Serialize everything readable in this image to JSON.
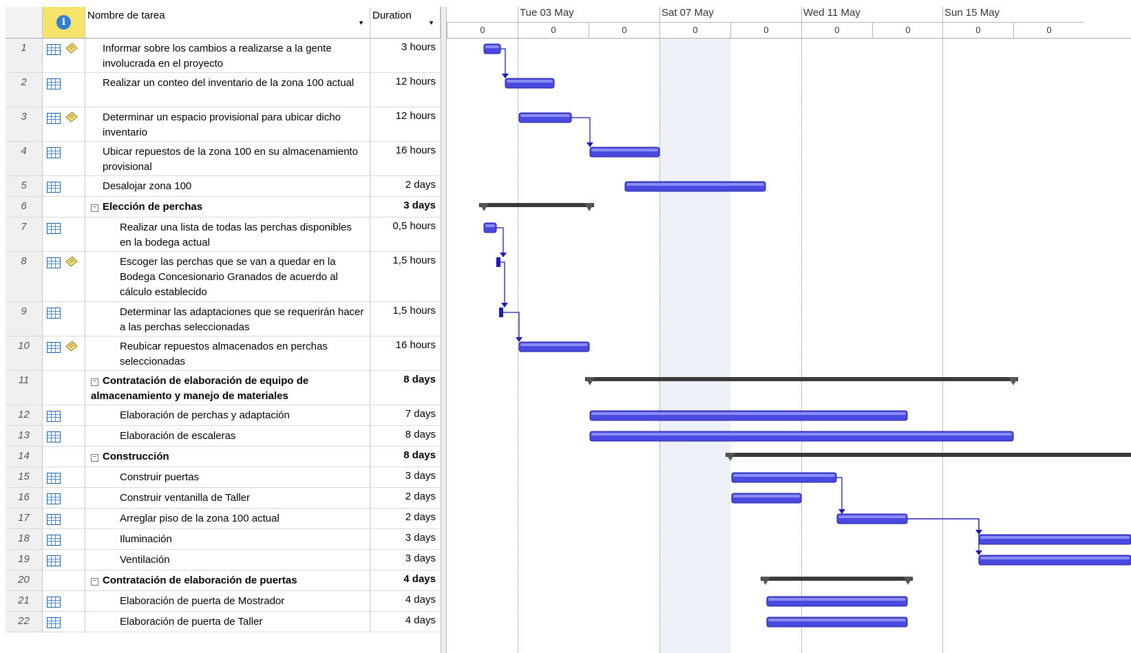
{
  "header": {
    "info_icon": "info-icon",
    "name_col": "Nombre de tarea",
    "duration_col": "Duration"
  },
  "timescale": {
    "weeks": [
      "Tue 03 May",
      "Sat 07 May",
      "Wed 11 May",
      "Sun 15 May"
    ],
    "day_labels": [
      "0",
      "0",
      "0",
      "0",
      "0",
      "0",
      "0",
      "0",
      "0"
    ]
  },
  "tasks": [
    {
      "id": "1",
      "name": "Informar sobre los cambios a realizarse a la gente involucrada en el proyecto",
      "duration": "3 hours",
      "indent": 0,
      "summary": false,
      "table_icon": true,
      "note_icon": true
    },
    {
      "id": "2",
      "name": "Realizar un conteo del inventario de la zona 100 actual",
      "duration": "12 hours",
      "indent": 0,
      "summary": false,
      "table_icon": true,
      "note_icon": false
    },
    {
      "id": "3",
      "name": "Determinar un espacio provisional para ubicar dicho inventario",
      "duration": "12 hours",
      "indent": 0,
      "summary": false,
      "table_icon": true,
      "note_icon": true
    },
    {
      "id": "4",
      "name": "Ubicar repuestos de la zona 100 en su almacenamiento provisional",
      "duration": "16 hours",
      "indent": 0,
      "summary": false,
      "table_icon": true,
      "note_icon": false
    },
    {
      "id": "5",
      "name": "Desalojar zona 100",
      "duration": "2 days",
      "indent": 0,
      "summary": false,
      "table_icon": true,
      "note_icon": false
    },
    {
      "id": "6",
      "name": "Elección de perchas",
      "duration": "3 days",
      "indent": 0,
      "summary": true,
      "table_icon": false,
      "note_icon": false
    },
    {
      "id": "7",
      "name": "Realizar una lista de todas las perchas disponibles en la bodega actual",
      "duration": "0,5 hours",
      "indent": 1,
      "summary": false,
      "table_icon": true,
      "note_icon": false
    },
    {
      "id": "8",
      "name": "Escoger las perchas que se van a quedar en la Bodega Concesionario Granados de acuerdo al cálculo establecido",
      "duration": "1,5 hours",
      "indent": 1,
      "summary": false,
      "table_icon": true,
      "note_icon": true
    },
    {
      "id": "9",
      "name": "Determinar las adaptaciones que se requerirán hacer a las perchas seleccionadas",
      "duration": "1,5 hours",
      "indent": 1,
      "summary": false,
      "table_icon": true,
      "note_icon": false
    },
    {
      "id": "10",
      "name": "Reubicar repuestos almacenados en perchas seleccionadas",
      "duration": "16 hours",
      "indent": 1,
      "summary": false,
      "table_icon": true,
      "note_icon": true
    },
    {
      "id": "11",
      "name": "Contratación de elaboración de equipo de almacenamiento y manejo de materiales",
      "duration": "8 days",
      "indent": 0,
      "summary": true,
      "table_icon": false,
      "note_icon": false
    },
    {
      "id": "12",
      "name": "Elaboración de perchas y adaptación",
      "duration": "7 days",
      "indent": 1,
      "summary": false,
      "table_icon": true,
      "note_icon": false
    },
    {
      "id": "13",
      "name": "Elaboración de escaleras",
      "duration": "8 days",
      "indent": 1,
      "summary": false,
      "table_icon": true,
      "note_icon": false
    },
    {
      "id": "14",
      "name": "Construcción",
      "duration": "8 days",
      "indent": 0,
      "summary": true,
      "table_icon": false,
      "note_icon": false
    },
    {
      "id": "15",
      "name": "Construir puertas",
      "duration": "3 days",
      "indent": 1,
      "summary": false,
      "table_icon": true,
      "note_icon": false
    },
    {
      "id": "16",
      "name": "Construir ventanilla de Taller",
      "duration": "2 days",
      "indent": 1,
      "summary": false,
      "table_icon": true,
      "note_icon": false
    },
    {
      "id": "17",
      "name": "Arreglar piso de la zona 100 actual",
      "duration": "2 days",
      "indent": 1,
      "summary": false,
      "table_icon": true,
      "note_icon": false
    },
    {
      "id": "18",
      "name": "Iluminación",
      "duration": "3 days",
      "indent": 1,
      "summary": false,
      "table_icon": true,
      "note_icon": false
    },
    {
      "id": "19",
      "name": "Ventilación",
      "duration": "3 days",
      "indent": 1,
      "summary": false,
      "table_icon": true,
      "note_icon": false
    },
    {
      "id": "20",
      "name": "Contratación de elaboración de puertas",
      "duration": "4 days",
      "indent": 0,
      "summary": true,
      "table_icon": false,
      "note_icon": false
    },
    {
      "id": "21",
      "name": "Elaboración de puerta de Mostrador",
      "duration": "4 days",
      "indent": 1,
      "summary": false,
      "table_icon": true,
      "note_icon": false
    },
    {
      "id": "22",
      "name": "Elaboración de puerta de Taller",
      "duration": "4 days",
      "indent": 1,
      "summary": false,
      "table_icon": true,
      "note_icon": false
    }
  ],
  "colors": {
    "task_bar": "#4a4ae0",
    "summary_bar": "#3a3a3a",
    "link": "#1a1ab8",
    "weekend_shade": "#eef0f8"
  }
}
